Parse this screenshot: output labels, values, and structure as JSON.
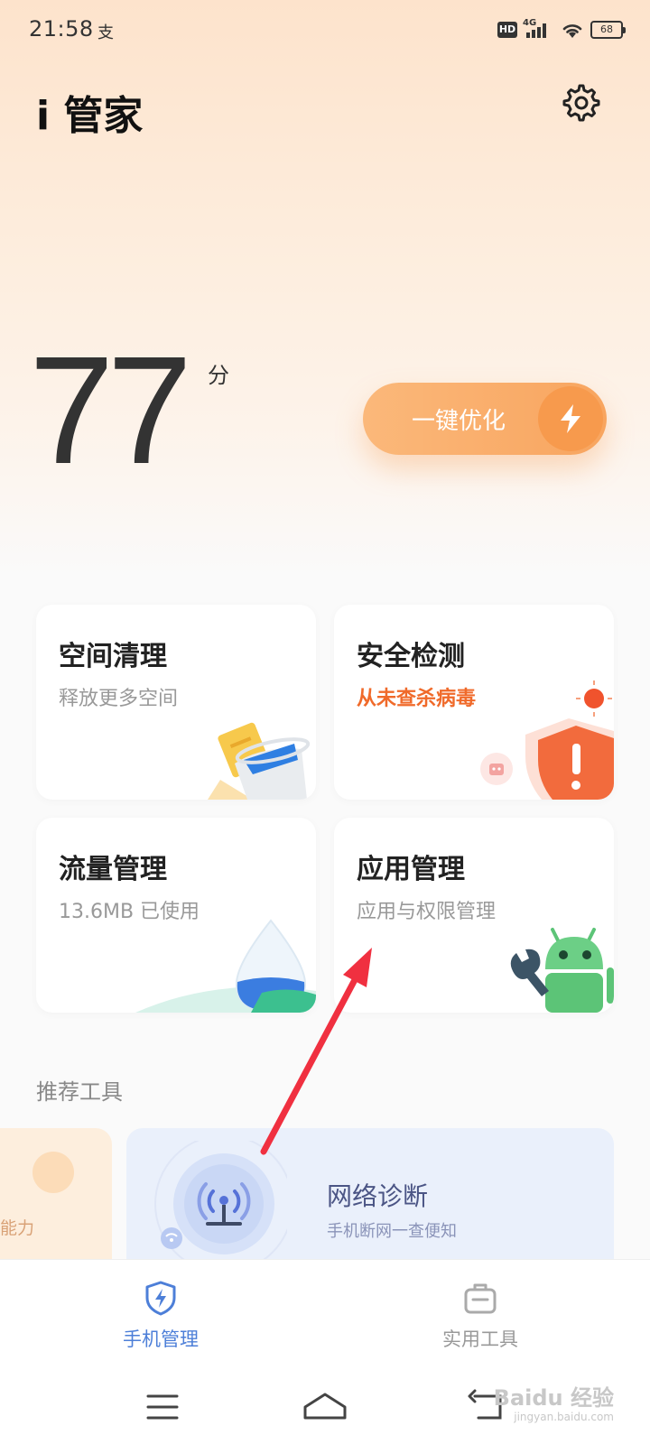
{
  "status_bar": {
    "time": "21:58",
    "app_notice": "支",
    "hd": "HD",
    "network": "4G",
    "battery": "68"
  },
  "header": {
    "title": "i 管家",
    "settings_icon": "gear-icon"
  },
  "score": {
    "value": "77",
    "unit": "分"
  },
  "optimize": {
    "label": "一键优化",
    "icon": "lightning-icon"
  },
  "cards": [
    {
      "title": "空间清理",
      "subtitle": "释放更多空间"
    },
    {
      "title": "安全检测",
      "subtitle": "从未查杀病毒",
      "subtitle_color": "#f06a2a"
    },
    {
      "title": "流量管理",
      "subtitle": "13.6MB 已使用"
    },
    {
      "title": "应用管理",
      "subtitle": "应用与权限管理"
    }
  ],
  "tools": {
    "section_title": "推荐工具",
    "left_partial_label": "能力",
    "network": {
      "title": "网络诊断",
      "subtitle": "手机断网一查便知"
    }
  },
  "tab_bar": {
    "tabs": [
      {
        "label": "手机管理",
        "icon": "shield-lightning-icon",
        "active": true
      },
      {
        "label": "实用工具",
        "icon": "toolbox-icon",
        "active": false
      }
    ],
    "accent": "#4d7fd8"
  },
  "nav_bar": {
    "watermark": "Baidu 经验",
    "watermark_sub": "jingyan.baidu.com"
  },
  "colors": {
    "accent_orange": "#f8a55f",
    "warning": "#f06a2a",
    "annotation_arrow": "#f03040"
  }
}
